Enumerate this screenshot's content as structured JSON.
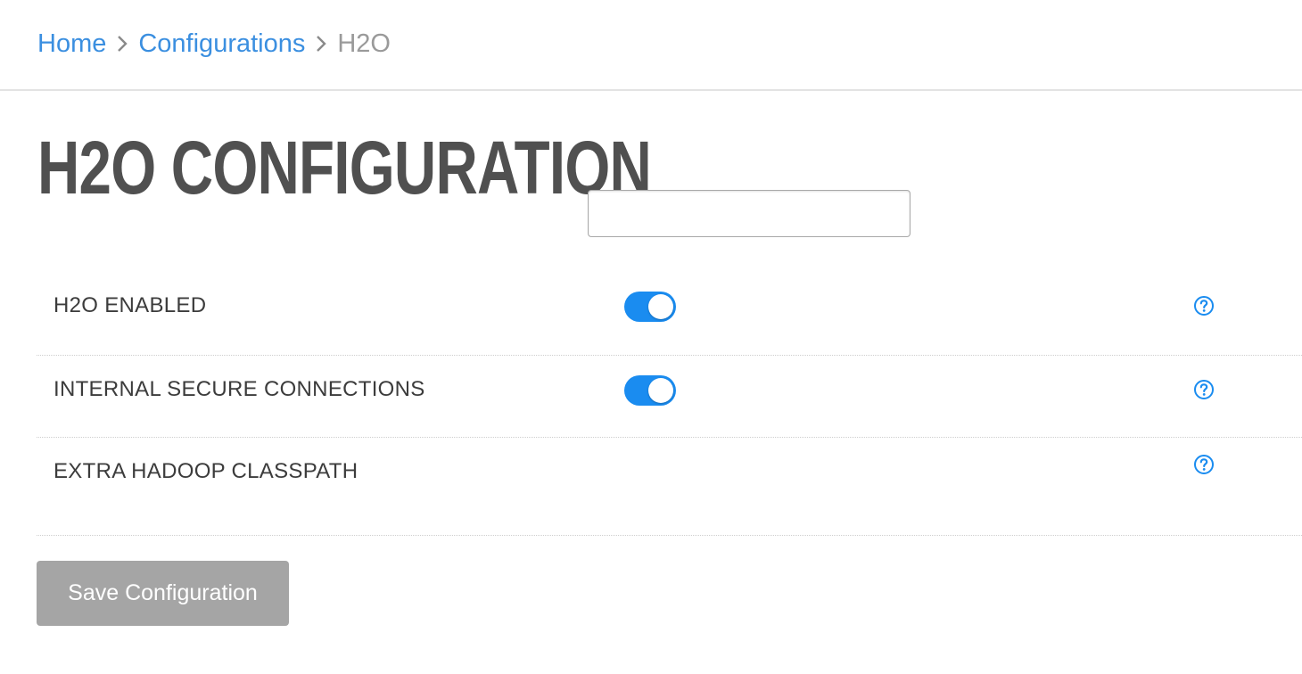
{
  "breadcrumb": {
    "home": "Home",
    "configurations": "Configurations",
    "current": "H2O"
  },
  "page": {
    "title": "H2O CONFIGURATION"
  },
  "settings": {
    "rows": [
      {
        "label": "H2O ENABLED",
        "control": "toggle",
        "enabled": true,
        "help_icon": "question-circle-icon"
      },
      {
        "label": "INTERNAL SECURE CONNECTIONS",
        "control": "toggle",
        "enabled": true,
        "help_icon": "question-circle-icon"
      },
      {
        "label": "EXTRA HADOOP CLASSPATH",
        "control": "text",
        "value": "",
        "placeholder": "",
        "help_icon": "question-circle-icon"
      }
    ]
  },
  "actions": {
    "save_label": "Save Configuration"
  },
  "colors": {
    "link": "#3b8fe0",
    "toggle_on": "#1a8cf0",
    "help_icon": "#1a8cf0",
    "save_button_bg": "#a5a5a5",
    "title": "#505050"
  }
}
